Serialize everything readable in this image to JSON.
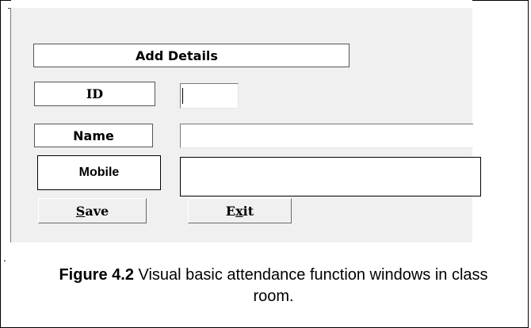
{
  "form": {
    "title": "Add  Details",
    "id_label": "ID",
    "name_label": "Name",
    "mobile_label": "Mobile",
    "id_value": "",
    "name_value": "",
    "mobile_value": "",
    "save_mnemonic": "S",
    "save_rest": "ave",
    "exit_start": "E",
    "exit_mnemonic": "x",
    "exit_rest": "it"
  },
  "figure": {
    "dot": ".",
    "caption_label": "Figure 4.2",
    "caption_text": " Visual basic attendance function windows in class room."
  }
}
